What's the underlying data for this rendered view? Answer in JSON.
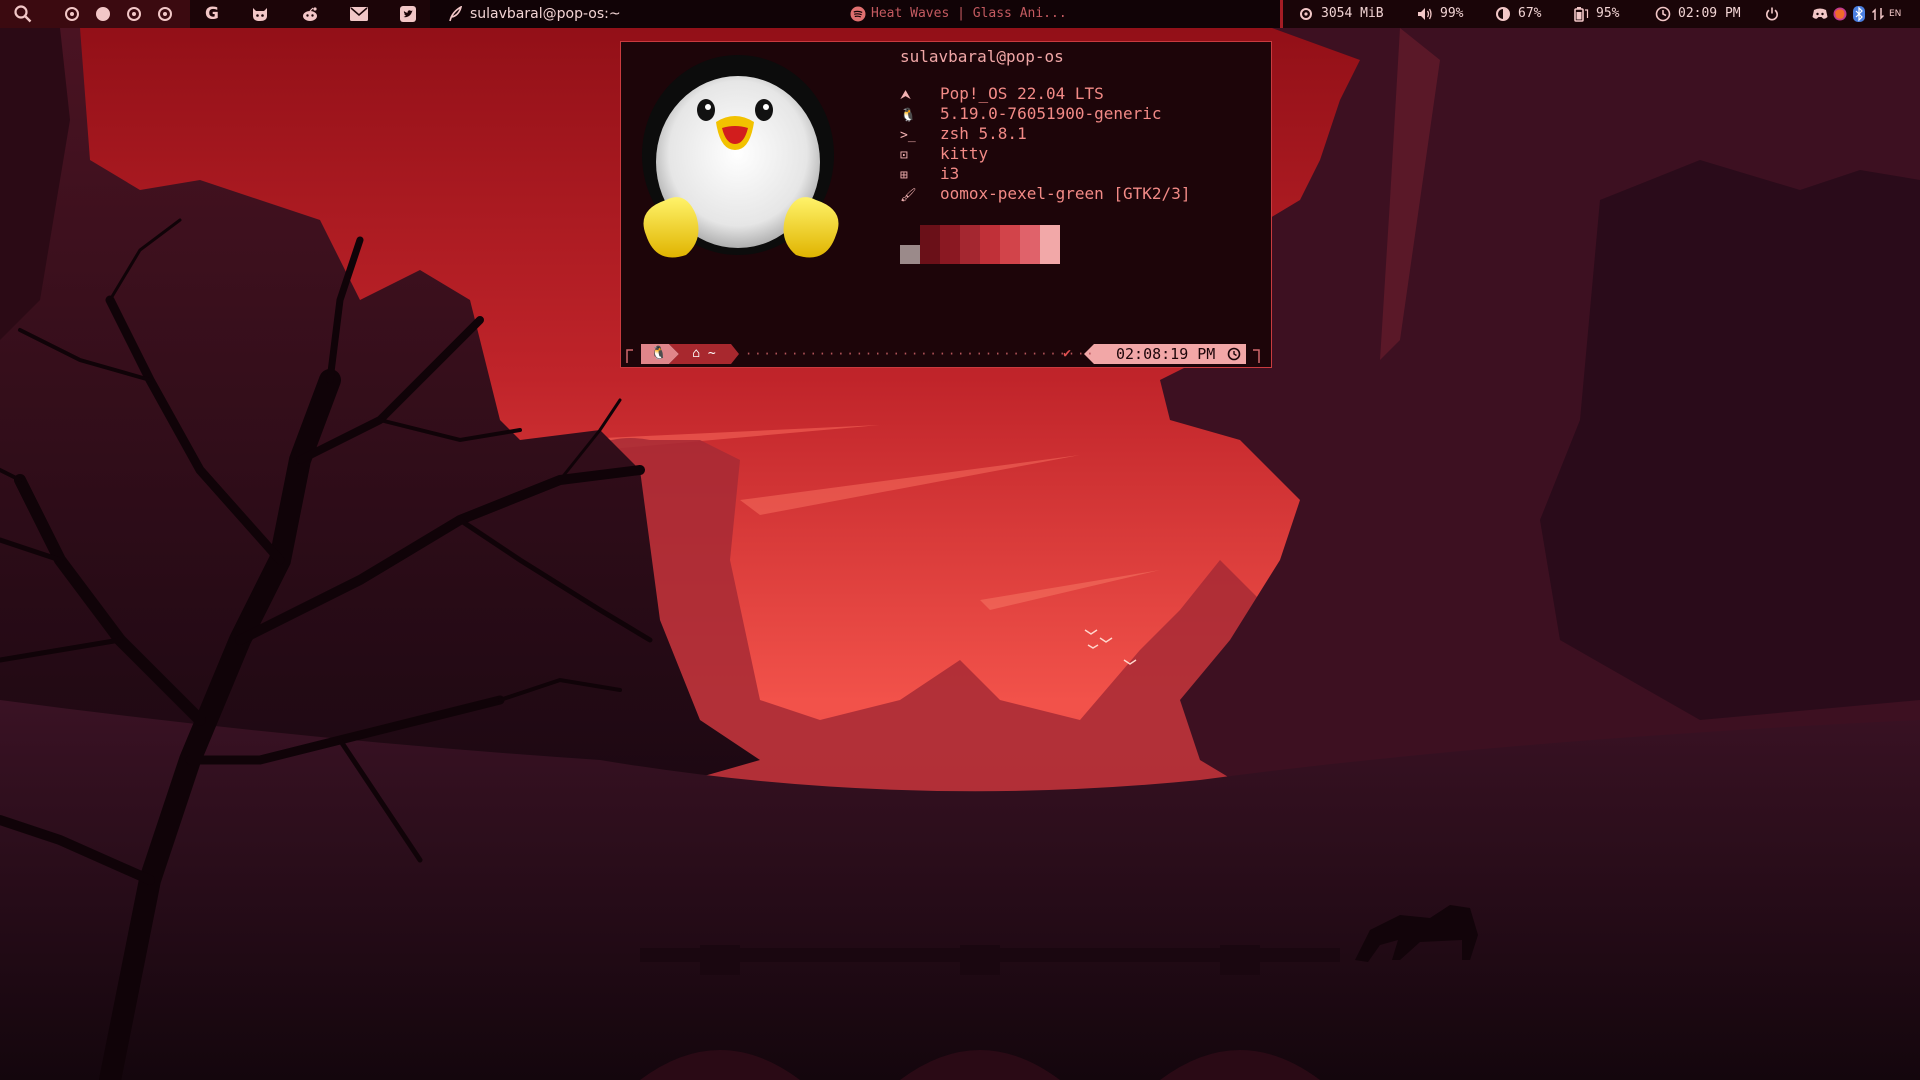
{
  "colors": {
    "accent": "#a51c24",
    "bar_dark": "#110306",
    "terminal_bg": "#1d0509",
    "terminal_border": "#c93b3f",
    "text_pink": "#f28a86"
  },
  "topbar": {
    "search_icon": "search-icon",
    "workspaces": [
      {
        "name": "workspace-1",
        "active": false
      },
      {
        "name": "workspace-2",
        "active": true
      },
      {
        "name": "workspace-3",
        "active": false
      },
      {
        "name": "workspace-4",
        "active": false
      }
    ],
    "apps": [
      "google-icon",
      "github-icon",
      "reddit-icon",
      "mail-icon",
      "twitter-icon"
    ],
    "window_title": "sulavbaral@pop-os:~",
    "now_playing": "Heat Waves | Glass Ani...",
    "memory": "3054 MiB",
    "volume": "99%",
    "brightness": "67%",
    "battery": "95%",
    "time": "02:09 PM",
    "keyboard_layout": "EN"
  },
  "terminal": {
    "user_host": "sulavbaral@pop-os",
    "info": [
      {
        "icon": "arch-icon",
        "glyph": "⮝",
        "value": "Pop!_OS 22.04 LTS"
      },
      {
        "icon": "linux-icon",
        "glyph": "🐧",
        "value": "5.19.0-76051900-generic"
      },
      {
        "icon": "shell-icon",
        "glyph": ">_",
        "value": "zsh 5.8.1"
      },
      {
        "icon": "terminal-icon",
        "glyph": "⊡",
        "value": "kitty"
      },
      {
        "icon": "wm-icon",
        "glyph": "⊞",
        "value": "i3"
      },
      {
        "icon": "theme-icon",
        "glyph": "🖌",
        "value": "oomox-pexel-green [GTK2/3]"
      }
    ],
    "palette": [
      "#9b8a8a",
      "#6a1018",
      "#8a1822",
      "#a42730",
      "#c03038",
      "#d2444a",
      "#e0626a",
      "#f2a8a8"
    ],
    "prompt": {
      "home_label": "~",
      "status": "✔",
      "clock": "02:08:19 PM"
    }
  }
}
